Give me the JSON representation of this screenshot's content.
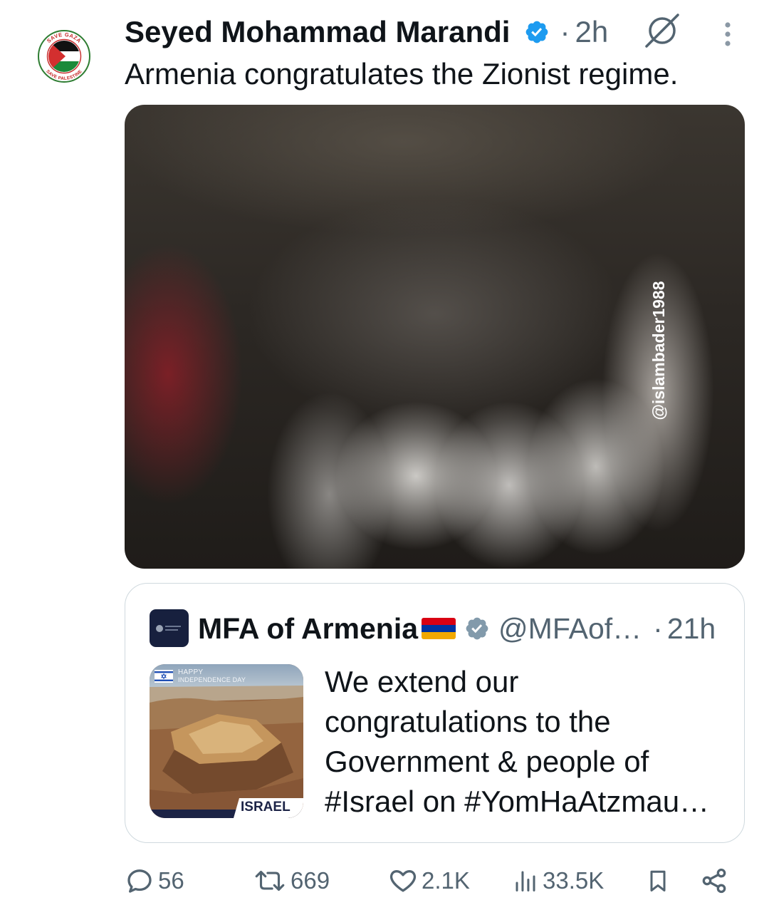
{
  "colors": {
    "text": "#0f1419",
    "secondary": "#536471",
    "border": "#cfd9de",
    "verified_blue": "#1d9bf0",
    "government_gray": "#829aab"
  },
  "post": {
    "author": {
      "name": "Seyed Mohammad Marandi",
      "verified": true,
      "avatar": {
        "ring_text_top": "SAVE GAZA",
        "ring_text_bottom": "SAVE PALESTINE"
      }
    },
    "separator": "·",
    "time": "2h",
    "text": "Armenia congratulates the Zionist regime.",
    "media": {
      "watermark": "@islambader1988"
    },
    "header_icons": [
      "grok-icon",
      "more-vertical-icon"
    ]
  },
  "quote": {
    "author": {
      "name": "MFA of Armenia",
      "flag": "armenia-flag-icon",
      "verified": true,
      "handle": "@MFAof…"
    },
    "separator": "·",
    "time": "21h",
    "thumbnail": {
      "banner_line1": "HAPPY",
      "banner_line2": "INDEPENDENCE DAY",
      "label": "ISRAEL"
    },
    "text_lines": [
      "We extend our",
      "congratulations to the",
      "Government & people of",
      "#Israel on #YomHaAtzmau…"
    ]
  },
  "actions": {
    "reply": {
      "icon": "reply-icon",
      "count": "56"
    },
    "repost": {
      "icon": "repost-icon",
      "count": "669"
    },
    "like": {
      "icon": "heart-icon",
      "count": "2.1K"
    },
    "views": {
      "icon": "views-icon",
      "count": "33.5K"
    },
    "bookmark": {
      "icon": "bookmark-icon"
    },
    "share": {
      "icon": "share-icon"
    }
  }
}
